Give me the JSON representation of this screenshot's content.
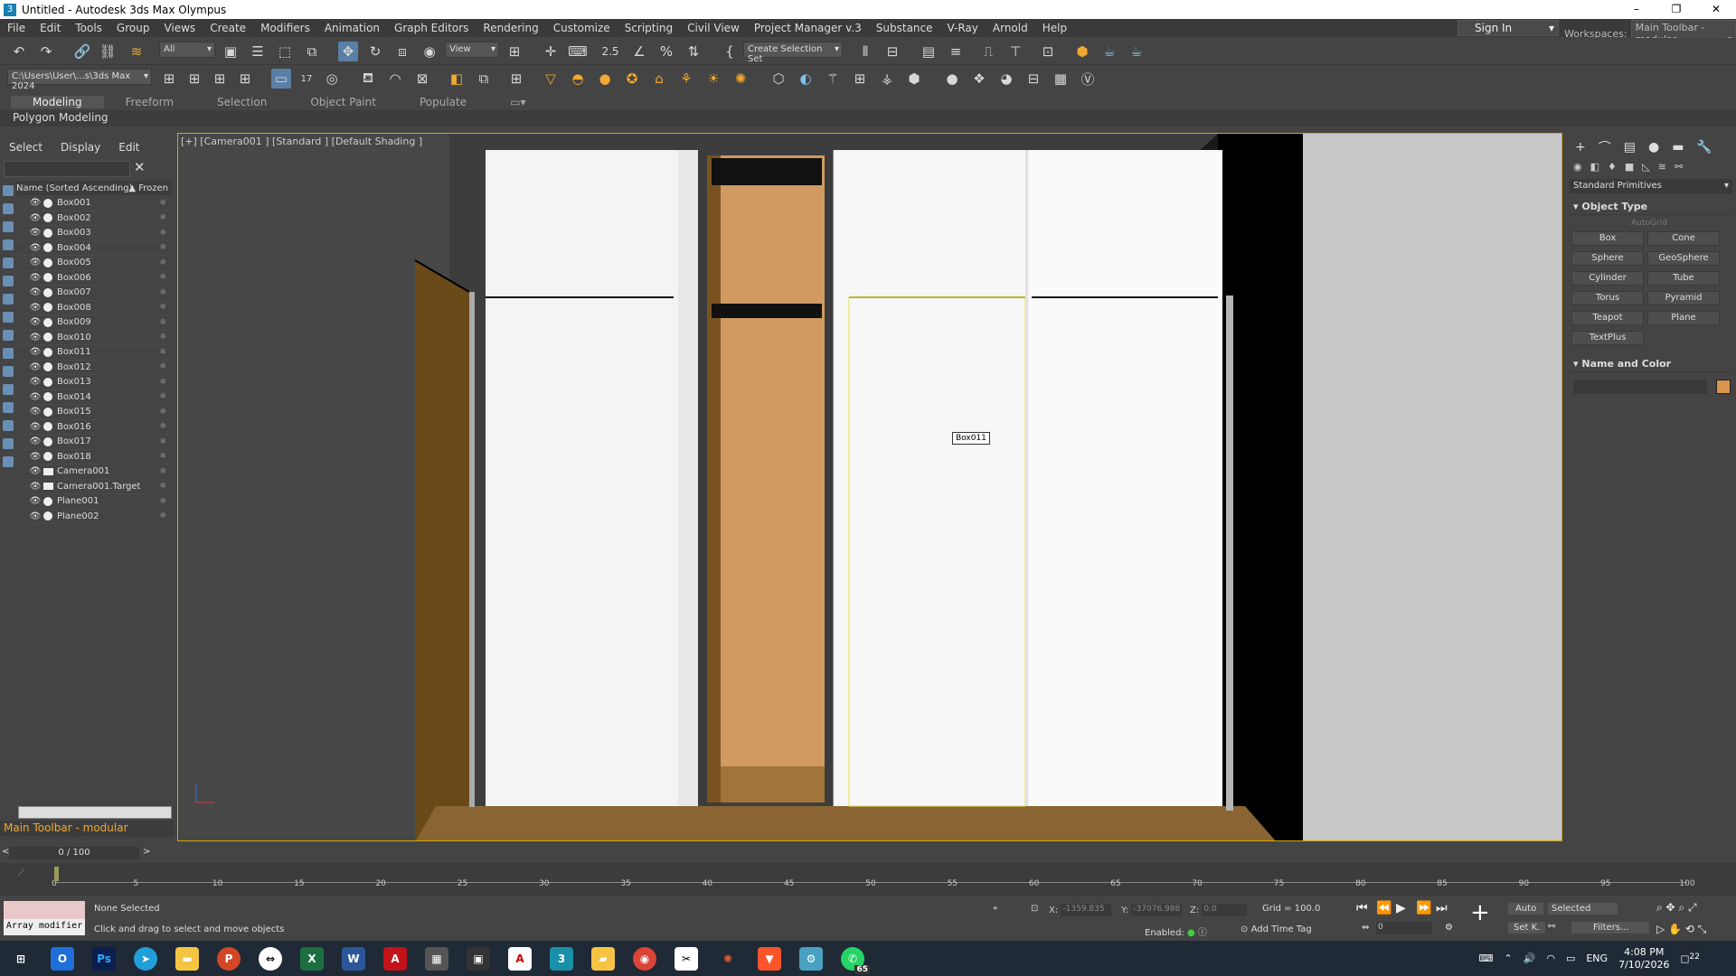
{
  "window": {
    "title": "Untitled - Autodesk 3ds Max Olympus",
    "minimize": "–",
    "maximize": "❐",
    "close": "✕"
  },
  "menu": [
    "File",
    "Edit",
    "Tools",
    "Group",
    "Views",
    "Create",
    "Modifiers",
    "Animation",
    "Graph Editors",
    "Rendering",
    "Customize",
    "Scripting",
    "Civil View",
    "Project Manager v.3",
    "Substance",
    "V-Ray",
    "Arnold",
    "Help"
  ],
  "signin": "Sign In",
  "workspaces": {
    "label": "Workspaces:",
    "value": "Main Toolbar - modular"
  },
  "toolbar": {
    "filter": "All",
    "refcoord": "View",
    "selset": "Create Selection Set",
    "path": "C:\\Users\\User\\...s\\3ds Max 2024",
    "snap_label": "2.5",
    "badge17": "17"
  },
  "ribbon": {
    "tabs": [
      "Modeling",
      "Freeform",
      "Selection",
      "Object Paint",
      "Populate"
    ],
    "active": "Modeling",
    "subtab": "Polygon Modeling"
  },
  "explorer": {
    "tabs": [
      "Select",
      "Display",
      "Edit"
    ],
    "col_name": "Name (Sorted Ascending)",
    "col_frozen": "▲ Frozen",
    "items": [
      {
        "name": "Box001",
        "type": "geo"
      },
      {
        "name": "Box002",
        "type": "geo"
      },
      {
        "name": "Box003",
        "type": "geo"
      },
      {
        "name": "Box004",
        "type": "geo"
      },
      {
        "name": "Box005",
        "type": "geo"
      },
      {
        "name": "Box006",
        "type": "geo"
      },
      {
        "name": "Box007",
        "type": "geo"
      },
      {
        "name": "Box008",
        "type": "geo"
      },
      {
        "name": "Box009",
        "type": "geo"
      },
      {
        "name": "Box010",
        "type": "geo"
      },
      {
        "name": "Box011",
        "type": "geo"
      },
      {
        "name": "Box012",
        "type": "geo"
      },
      {
        "name": "Box013",
        "type": "geo"
      },
      {
        "name": "Box014",
        "type": "geo"
      },
      {
        "name": "Box015",
        "type": "geo"
      },
      {
        "name": "Box016",
        "type": "geo"
      },
      {
        "name": "Box017",
        "type": "geo"
      },
      {
        "name": "Box018",
        "type": "geo"
      },
      {
        "name": "Camera001",
        "type": "cam"
      },
      {
        "name": "Camera001.Target",
        "type": "cam"
      },
      {
        "name": "Plane001",
        "type": "geo"
      },
      {
        "name": "Plane002",
        "type": "geo"
      }
    ],
    "workspace_label": "Main Toolbar - modular"
  },
  "viewport": {
    "label": "[+] [Camera001 ] [Standard ] [Default Shading ]",
    "tooltip": "Box011"
  },
  "command_panel": {
    "dropdown": "Standard Primitives",
    "object_type": "Object Type",
    "autogrid": "AutoGrid",
    "buttons": [
      "Box",
      "Cone",
      "Sphere",
      "GeoSphere",
      "Cylinder",
      "Tube",
      "Torus",
      "Pyramid",
      "Teapot",
      "Plane",
      "TextPlus"
    ],
    "name_color": "Name and Color",
    "color": "#d9954f"
  },
  "time": {
    "slider": "0 / 100",
    "ticks": [
      "0",
      "5",
      "10",
      "15",
      "20",
      "25",
      "30",
      "35",
      "40",
      "45",
      "50",
      "55",
      "60",
      "65",
      "70",
      "75",
      "80",
      "85",
      "90",
      "95",
      "100"
    ]
  },
  "status": {
    "maxscript": "Array modifier",
    "selection": "None Selected",
    "prompt": "Click and drag to select and move objects",
    "x_label": "X:",
    "x_val": "-1359.835",
    "y_label": "Y:",
    "y_val": "-37076.988",
    "z_label": "Z:",
    "z_val": "0.0",
    "grid": "Grid = 100.0",
    "enabled": "Enabled:",
    "addtag": "Add Time Tag",
    "auto": "Auto",
    "selected": "Selected",
    "setk": "Set K.",
    "filters": "Filters...",
    "frame": "0"
  },
  "taskbar": {
    "time": "4:08 PM",
    "date": "7/10/2026",
    "lang": "ENG",
    "notif": "22",
    "whatsapp_badge": "65"
  }
}
